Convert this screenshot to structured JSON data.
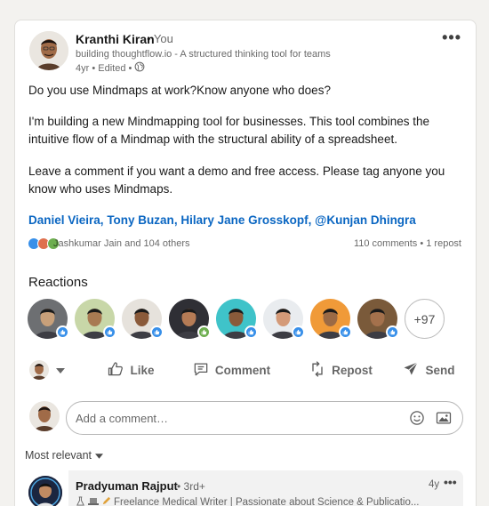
{
  "post": {
    "author": {
      "name": "Kranthi Kiran",
      "you_label": "• You",
      "headline": "building thoughtflow.io - A structured thinking tool for teams",
      "meta": "4yr • Edited •"
    },
    "more_label": "•••",
    "body": {
      "line1": "Do you use Mindmaps at work?Know anyone who does?",
      "para2": "I'm building a new Mindmapping tool for businesses. This tool combines the intuitive flow of a Mindmap with the structural ability of a spreadsheet.",
      "para3": "Leave a comment if you want a demo and free access. Please tag anyone you know who uses Mindmaps."
    },
    "mentions": [
      "Daniel Vieira",
      "Tony Buzan",
      "Hilary Jane Grosskopf",
      "@Kunjan Dhingra"
    ]
  },
  "social": {
    "names": "Jashkumar Jain and 104 others",
    "counts": "110 comments • 1 repost"
  },
  "reactions": {
    "title": "Reactions",
    "more": "+97",
    "avatars": [
      {
        "bg": "#6d6f72",
        "skin": "#c8a07a",
        "badge": "like-icon"
      },
      {
        "bg": "#c8d7a8",
        "skin": "#a87a52",
        "badge": "like-icon"
      },
      {
        "bg": "#e6e2dc",
        "skin": "#8a5a3a",
        "badge": "like-icon"
      },
      {
        "bg": "#2f2f35",
        "skin": "#b57b55",
        "badge": "celebrate-icon"
      },
      {
        "bg": "#3fc3c9",
        "skin": "#8a5a3a",
        "badge": "like-icon"
      },
      {
        "bg": "#e9ecef",
        "skin": "#d49a78",
        "badge": "like-icon"
      },
      {
        "bg": "#f09a38",
        "skin": "#9b6a45",
        "badge": "like-icon"
      },
      {
        "bg": "#7a5a3a",
        "skin": "#a4714c",
        "badge": "like-icon"
      }
    ]
  },
  "actions": {
    "like": "Like",
    "comment": "Comment",
    "repost": "Repost",
    "send": "Send"
  },
  "comment_box": {
    "placeholder": "Add a comment…"
  },
  "sort": {
    "label": "Most relevant"
  },
  "first_comment": {
    "name": "Pradyuman Rajput",
    "degree": "• 3rd+",
    "time": "4y",
    "more": "•••",
    "headline": "Freelance Medical Writer | Passionate about Science & Publicatio..."
  },
  "colors": {
    "link": "#0a66c2",
    "like_badge": "#378fe9",
    "celebrate_badge": "#6dae4f"
  }
}
